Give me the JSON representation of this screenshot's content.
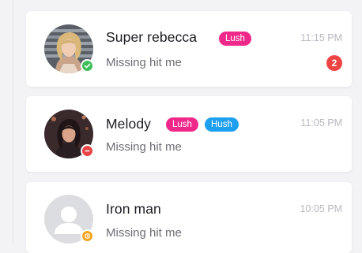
{
  "colors": {
    "lush_tag": "#f0288a",
    "hush_tag": "#1ea0f0",
    "online_status": "#3cbf5a",
    "busy_status": "#e84545",
    "away_status": "#f2a622",
    "unread_badge": "#ef4444"
  },
  "conversations": [
    {
      "name": "Super rebecca",
      "tags": [
        "Lush"
      ],
      "message": "Missing hit me",
      "time": "11:15 PM",
      "unread": "2",
      "status": "online",
      "avatar_icon": "user-photo-icon"
    },
    {
      "name": "Melody",
      "tags": [
        "Lush",
        "Hush"
      ],
      "message": "Missing hit me",
      "time": "11:05 PM",
      "status": "busy",
      "avatar_icon": "user-photo-icon"
    },
    {
      "name": "Iron man",
      "tags": [],
      "message": "Missing hit me",
      "time": "10:05 PM",
      "status": "away",
      "avatar_icon": "default-user-icon"
    }
  ]
}
